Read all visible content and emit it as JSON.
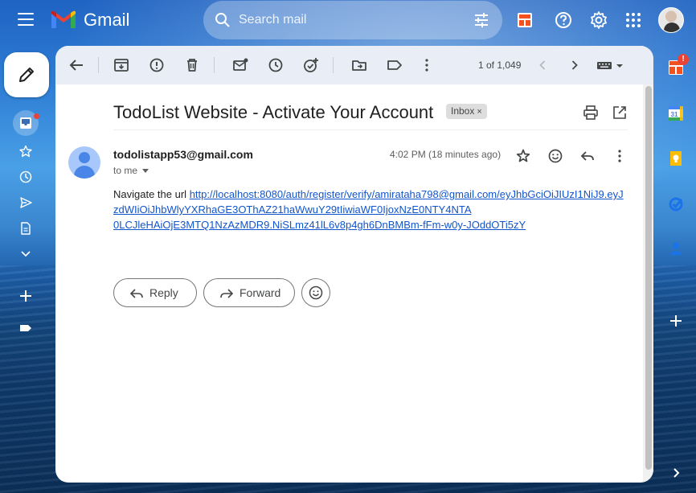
{
  "app": {
    "logo_text": "Gmail"
  },
  "search": {
    "placeholder": "Search mail"
  },
  "toolbar": {
    "pagination": "1 of 1,049"
  },
  "email": {
    "subject": "TodoList Website - Activate Your Account",
    "label": "Inbox",
    "label_remove": "×",
    "sender": "todolistapp53@gmail.com",
    "recipient_text": "to me",
    "time": "4:02 PM (18 minutes ago)",
    "body_prefix": "Navigate the url",
    "url_lines": [
      "http://localhost:8080/auth/register/verify/amirataha798@gmail.com/eyJhbGciOiJIUzI1NiJ9.eyJ",
      "zdWIiOiJhbWlyYXRhaGE3OThAZ21haWwuY29tIiwiaWF0IjoxNzE0NTY4NTA",
      "0LCJleHAiOjE3MTQ1NzAzMDR9.NiSLmz41lL6v8p4gh6DnBMBm-fFm-w0y-JOddOTi5zY"
    ]
  },
  "actions": {
    "reply": "Reply",
    "forward": "Forward"
  },
  "right_panel": {
    "badge": "!",
    "calendar_day": "31"
  },
  "colors": {
    "accent_blue": "#0b57d0",
    "link": "#1155cc",
    "toolbar_bg": "#e9eef6"
  }
}
